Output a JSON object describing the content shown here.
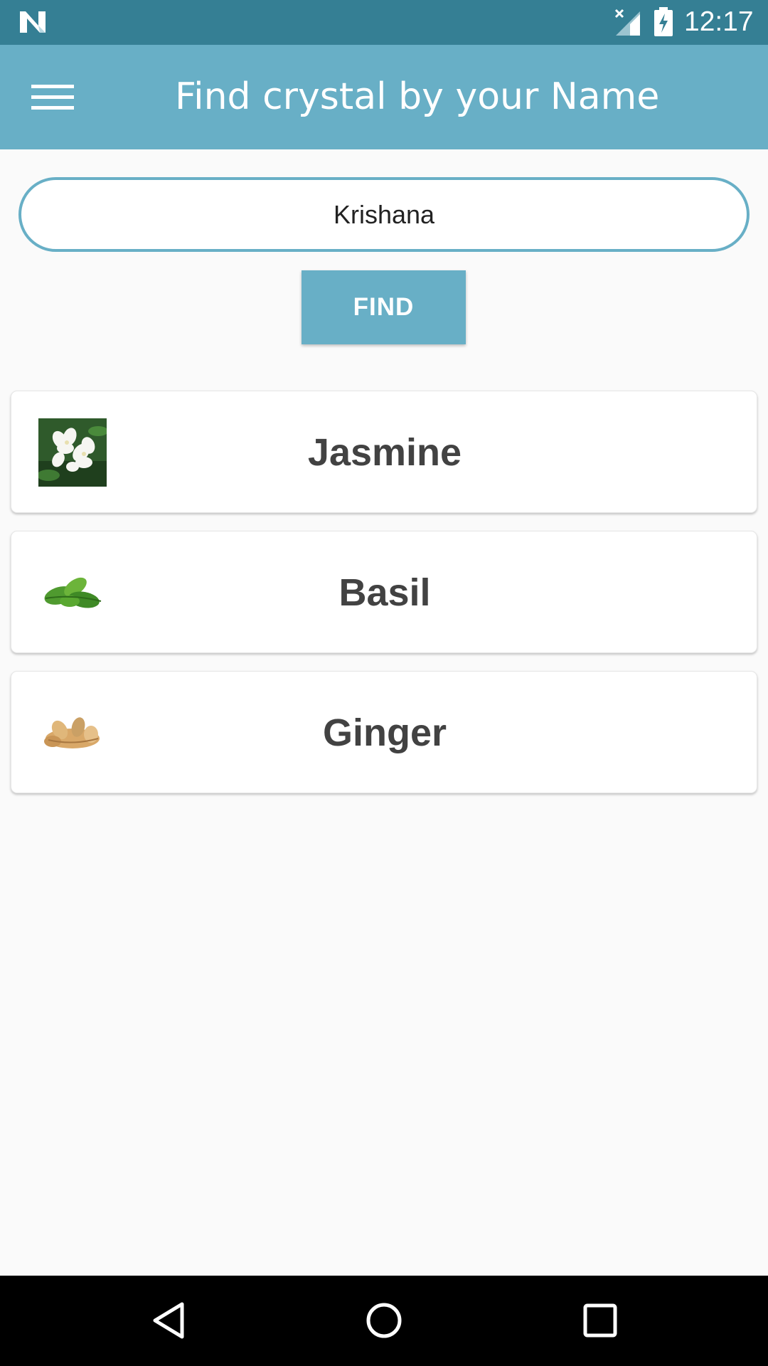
{
  "status_bar": {
    "time": "12:17",
    "icons": [
      "n-logo-icon",
      "no-signal-icon",
      "battery-charging-icon"
    ]
  },
  "app_bar": {
    "menu_icon": "hamburger-menu-icon",
    "title": "Find crystal by your Name"
  },
  "search": {
    "value": "Krishana",
    "placeholder": ""
  },
  "find_button": {
    "label": "FIND"
  },
  "results": [
    {
      "label": "Jasmine",
      "icon": "jasmine-flower-image"
    },
    {
      "label": "Basil",
      "icon": "basil-leaf-image"
    },
    {
      "label": "Ginger",
      "icon": "ginger-root-image"
    }
  ],
  "nav_bar": {
    "buttons": [
      "back-icon",
      "home-icon",
      "recents-icon"
    ]
  },
  "colors": {
    "status_bar": "#357f94",
    "app_bar": "#68afc6",
    "accent": "#68afc6",
    "background": "#fafafa",
    "card_text": "#424242"
  }
}
